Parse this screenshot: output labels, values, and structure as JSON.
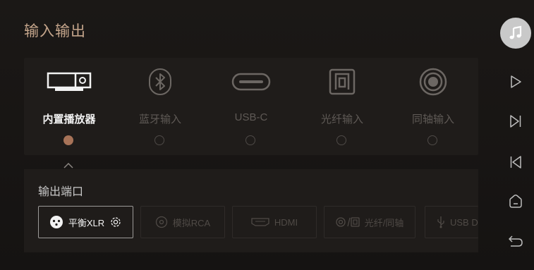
{
  "title": "输入输出",
  "sources": [
    {
      "label": "内置播放器",
      "icon": "player-icon",
      "active": true
    },
    {
      "label": "蓝牙输入",
      "icon": "bluetooth-icon",
      "active": false
    },
    {
      "label": "USB-C",
      "icon": "usb-c-icon",
      "active": false
    },
    {
      "label": "光纤输入",
      "icon": "optical-icon",
      "active": false
    },
    {
      "label": "同轴输入",
      "icon": "coaxial-icon",
      "active": false
    }
  ],
  "output": {
    "title": "输出端口",
    "ports": [
      {
        "label": "平衡XLR",
        "icon": "xlr-icon",
        "active": true
      },
      {
        "label": "模拟RCA",
        "icon": "rca-icon",
        "active": false
      },
      {
        "label": "HDMI",
        "icon": "hdmi-icon",
        "active": false
      },
      {
        "label": "光纤/同轴",
        "icon": "optical-coaxial-icon",
        "active": false
      },
      {
        "label": "USB D",
        "icon": "usb-icon",
        "active": false
      }
    ]
  },
  "sidebar": [
    "music-icon",
    "play-icon",
    "next-icon",
    "previous-icon",
    "home-icon",
    "back-icon"
  ],
  "colors": {
    "accent": "#c4a58b",
    "active_dot": "#a77358",
    "inactive": "#5f5a56"
  }
}
